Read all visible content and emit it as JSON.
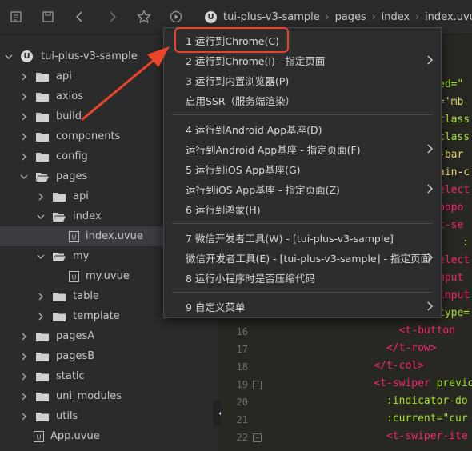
{
  "breadcrumb": {
    "project": "tui-plus-v3-sample",
    "folder": "pages",
    "subfolder": "index",
    "file": "index.uvue"
  },
  "sidebar": {
    "items": [
      {
        "label": "tui-plus-v3-sample",
        "type": "project",
        "expanded": true
      },
      {
        "label": "api",
        "type": "folder"
      },
      {
        "label": "axios",
        "type": "folder"
      },
      {
        "label": "build",
        "type": "folder"
      },
      {
        "label": "components",
        "type": "folder"
      },
      {
        "label": "config",
        "type": "folder"
      },
      {
        "label": "pages",
        "type": "folder",
        "expanded": true
      },
      {
        "label": "api",
        "type": "folder"
      },
      {
        "label": "index",
        "type": "folder",
        "expanded": true
      },
      {
        "label": "index.uvue",
        "type": "file",
        "selected": true
      },
      {
        "label": "my",
        "type": "folder",
        "expanded": true
      },
      {
        "label": "my.uvue",
        "type": "file"
      },
      {
        "label": "table",
        "type": "folder"
      },
      {
        "label": "template",
        "type": "folder"
      },
      {
        "label": "pagesA",
        "type": "folder"
      },
      {
        "label": "pagesB",
        "type": "folder"
      },
      {
        "label": "static",
        "type": "folder"
      },
      {
        "label": "uni_modules",
        "type": "folder"
      },
      {
        "label": "utils",
        "type": "folder"
      },
      {
        "label": "App.uvue",
        "type": "file"
      }
    ]
  },
  "menu": {
    "items": [
      {
        "label": "1 运行到Chrome(C)",
        "submenu": false
      },
      {
        "label": "2 运行到Chrome(I) - 指定页面",
        "submenu": true
      },
      {
        "label": "3 运行到内置浏览器(P)",
        "submenu": false
      },
      {
        "label": "启用SSR（服务端渲染）",
        "submenu": false
      },
      {
        "label": "4 运行到Android App基座(D)",
        "submenu": false
      },
      {
        "label": "运行到Android App基座 - 指定页面(F)",
        "submenu": true
      },
      {
        "label": "5 运行到iOS App基座(G)",
        "submenu": false
      },
      {
        "label": "运行到iOS App基座 - 指定页面(Z)",
        "submenu": true
      },
      {
        "label": "6 运行到鸿蒙(H)",
        "submenu": false
      },
      {
        "label": "7 微信开发者工具(W) - [tui-plus-v3-sample]",
        "submenu": false
      },
      {
        "label": "微信开发者工具(E) - [tui-plus-v3-sample] - 指定页面",
        "submenu": true
      },
      {
        "label": "8 运行小程序时是否压缩代码",
        "submenu": false
      },
      {
        "label": "9 自定义菜单",
        "submenu": true
      }
    ]
  },
  "editor": {
    "line_numbers": [
      "16",
      "17",
      "18",
      "19",
      "20",
      "21",
      "22"
    ],
    "partial": [
      "ed=\"",
      "='mb",
      "class",
      "class",
      "-bar",
      "ain-c",
      "elect",
      "popo",
      "t-se",
      ":",
      "elect",
      "nput",
      "input",
      "type="
    ],
    "lines": [
      {
        "indent": "        ",
        "tag": "<t-button",
        "rest": ""
      },
      {
        "indent": "      ",
        "tag": "</t-row>",
        "rest": ""
      },
      {
        "indent": "    ",
        "tag": "</t-col>",
        "rest": ""
      },
      {
        "indent": "    ",
        "tag": "<t-swiper",
        "rest": " previou"
      },
      {
        "indent": "      ",
        "tag": "",
        "rest": ":indicator-do"
      },
      {
        "indent": "      ",
        "tag": "",
        "rest": ":current=\"cur"
      },
      {
        "indent": "      ",
        "tag": "<t-swiper-ite",
        "rest": ""
      }
    ]
  },
  "colors": {
    "highlight": "#e8452a",
    "tag": "#f92672",
    "attr": "#a6e22e",
    "string": "#e6db74"
  }
}
